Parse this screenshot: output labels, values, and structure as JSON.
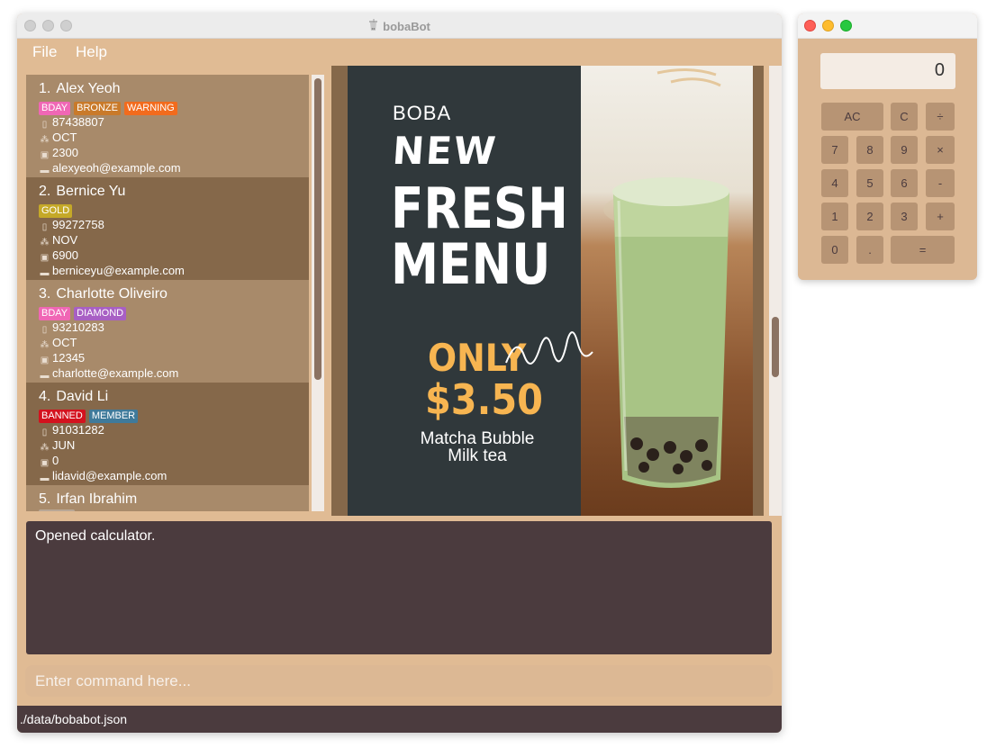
{
  "main_window": {
    "title": "bobaBot",
    "menu": [
      "File",
      "Help"
    ]
  },
  "persons": [
    {
      "index": "1.",
      "name": "Alex Yeoh",
      "tags": [
        {
          "label": "BDAY",
          "color": "#f067b5"
        },
        {
          "label": "BRONZE",
          "color": "#c97a2a"
        },
        {
          "label": "WARNING",
          "color": "#f26b1d"
        }
      ],
      "phone": "87438807",
      "birthday_month": "OCT",
      "reward_points": "2300",
      "email": "alexyeoh@example.com"
    },
    {
      "index": "2.",
      "name": "Bernice Yu",
      "tags": [
        {
          "label": "GOLD",
          "color": "#c5a928"
        }
      ],
      "phone": "99272758",
      "birthday_month": "NOV",
      "reward_points": "6900",
      "email": "berniceyu@example.com"
    },
    {
      "index": "3.",
      "name": "Charlotte Oliveiro",
      "tags": [
        {
          "label": "BDAY",
          "color": "#f067b5"
        },
        {
          "label": "DIAMOND",
          "color": "#a85fc4"
        }
      ],
      "phone": "93210283",
      "birthday_month": "OCT",
      "reward_points": "12345",
      "email": "charlotte@example.com"
    },
    {
      "index": "4.",
      "name": "David Li",
      "tags": [
        {
          "label": "BANNED",
          "color": "#d3121e"
        },
        {
          "label": "MEMBER",
          "color": "#3f7a9a"
        }
      ],
      "phone": "91031282",
      "birthday_month": "JUN",
      "reward_points": "0",
      "email": "lidavid@example.com"
    },
    {
      "index": "5.",
      "name": "Irfan Ibrahim",
      "tags": [],
      "phone": "",
      "birthday_month": "",
      "reward_points": "",
      "email": ""
    }
  ],
  "promo": {
    "boba": "BOBA",
    "new": "NEW",
    "fresh": "FRESH",
    "menu": "MENU",
    "only": "ONLY",
    "price": "$3.50",
    "desc_line1": "Matcha Bubble",
    "desc_line2": "Milk tea",
    "dark_color": "#30383b",
    "accent_color": "#f7b551"
  },
  "result_text": "Opened calculator.",
  "command": {
    "value": "",
    "placeholder": "Enter command here..."
  },
  "status_path": "./data/bobabot.json",
  "calculator": {
    "display": "0",
    "buttons": [
      "AC",
      "C",
      "÷",
      "7",
      "8",
      "9",
      "×",
      "4",
      "5",
      "6",
      "-",
      "1",
      "2",
      "3",
      "+",
      "0",
      ".",
      "="
    ]
  },
  "colors": {
    "window_bg": "#e0bb94",
    "card_light": "#a88a6a",
    "card_dark": "#85684a",
    "result_bg": "#4b3b3e"
  }
}
